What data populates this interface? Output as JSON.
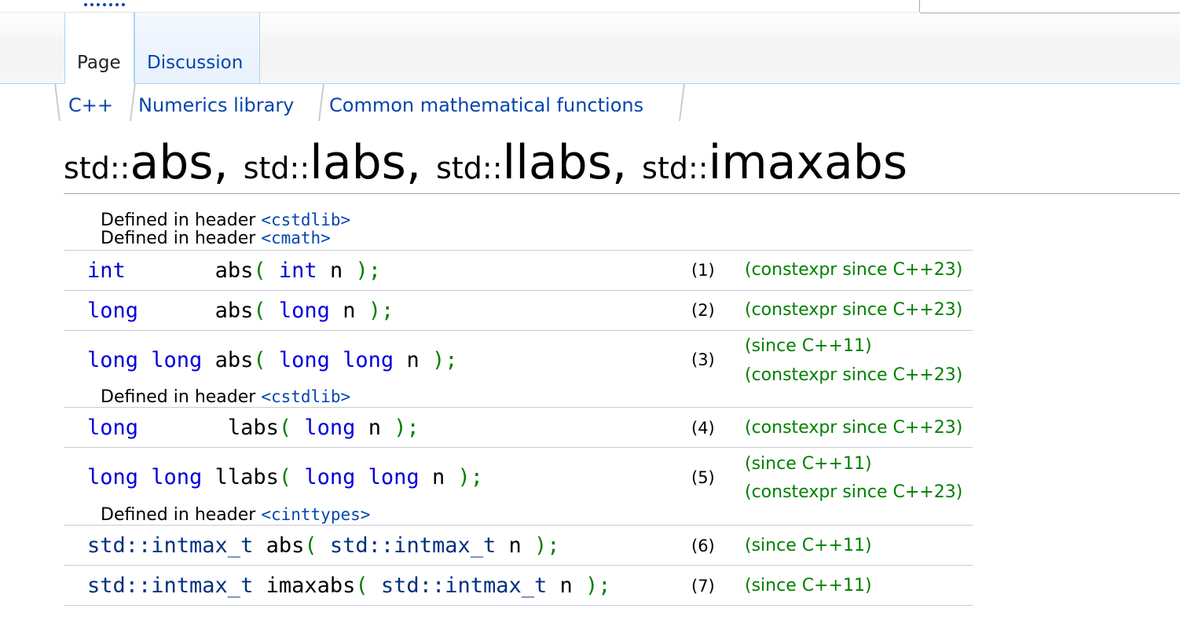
{
  "tabs": {
    "page": "Page",
    "discussion": "Discussion"
  },
  "breadcrumb": [
    "C++",
    "Numerics library",
    "Common mathematical functions"
  ],
  "title": {
    "ns1": "std::",
    "fn1": "abs",
    "sep1": ", ",
    "ns2": "std::",
    "fn2": "labs",
    "sep2": ", ",
    "ns3": "std::",
    "fn3": "llabs",
    "sep3": ", ",
    "ns4": "std::",
    "fn4": "imaxabs"
  },
  "headers": {
    "defined_in": "Defined in header",
    "cstdlib": "<cstdlib>",
    "cmath": "<cmath>",
    "cinttypes": "<cinttypes>"
  },
  "declarations": [
    {
      "ret": "int",
      "pad": "       ",
      "name": "abs",
      "open": "(",
      "ptype": "int",
      "param": "n",
      "close": ");",
      "number": "(1)",
      "since1": "(constexpr since C++23)",
      "since2": ""
    },
    {
      "ret": "long",
      "pad": "      ",
      "name": "abs",
      "open": "(",
      "ptype": "long",
      "param": "n",
      "close": ");",
      "number": "(2)",
      "since1": "(constexpr since C++23)",
      "since2": ""
    },
    {
      "ret": "long long",
      "pad": " ",
      "name": "abs",
      "open": "(",
      "ptype": "long long",
      "param": "n",
      "close": ");",
      "number": "(3)",
      "since1": "(since C++11)",
      "since2": "(constexpr since C++23)"
    },
    {
      "ret": "long",
      "pad": "       ",
      "name": "labs",
      "open": "(",
      "ptype": "long",
      "param": "n",
      "close": ");",
      "number": "(4)",
      "since1": "(constexpr since C++23)",
      "since2": ""
    },
    {
      "ret": "long long",
      "pad": " ",
      "name": "llabs",
      "open": "(",
      "ptype": "long long",
      "param": "n",
      "close": ");",
      "number": "(5)",
      "since1": "(since C++11)",
      "since2": "(constexpr since C++23)"
    },
    {
      "ret": "std::intmax_t",
      "pad": " ",
      "name": "abs",
      "open": "(",
      "ptype": "std::intmax_t",
      "param": "n",
      "close": ");",
      "number": "(6)",
      "since1": "(since C++11)",
      "since2": ""
    },
    {
      "ret": "std::intmax_t",
      "pad": " ",
      "name": "imaxabs",
      "open": "(",
      "ptype": "std::intmax_t",
      "param": "n",
      "close": ");",
      "number": "(7)",
      "since1": "(since C++11)",
      "since2": ""
    }
  ]
}
